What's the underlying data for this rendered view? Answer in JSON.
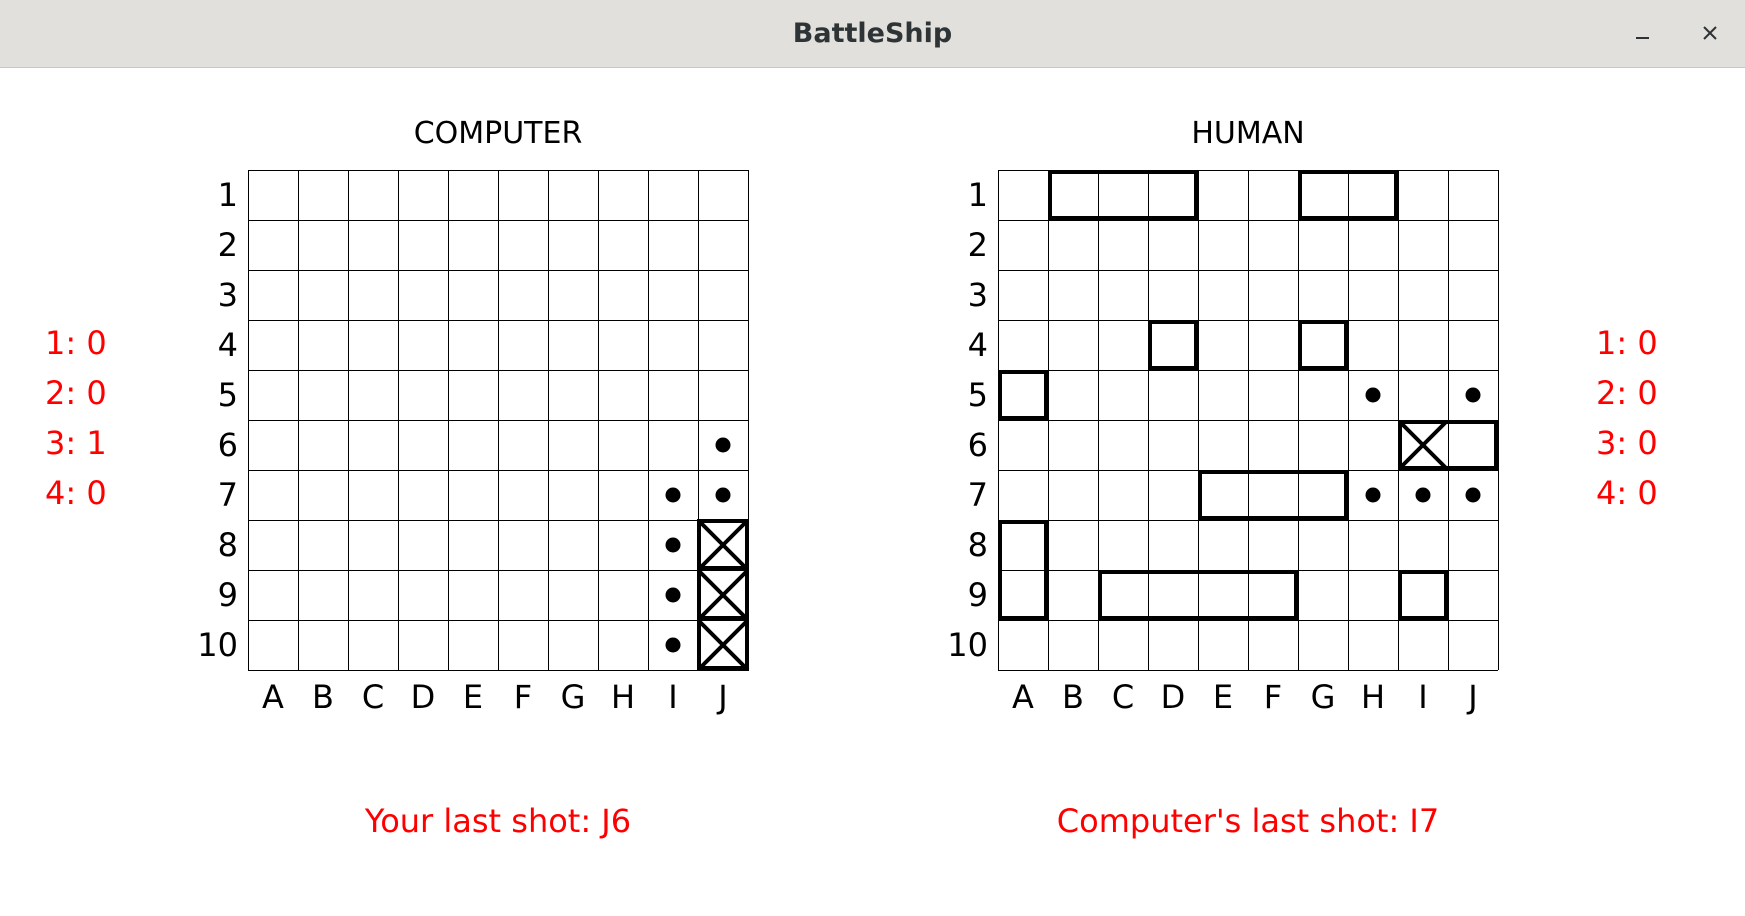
{
  "window": {
    "title": "BattleShip"
  },
  "boards": [
    {
      "id": "computer",
      "title": "COMPUTER",
      "columns": [
        "A",
        "B",
        "C",
        "D",
        "E",
        "F",
        "G",
        "H",
        "I",
        "J"
      ],
      "rows": [
        "1",
        "2",
        "3",
        "4",
        "5",
        "6",
        "7",
        "8",
        "9",
        "10"
      ],
      "ships": [],
      "hits": [
        "J8",
        "J9",
        "J10"
      ],
      "hit_blocks": [
        {
          "start": "J8",
          "end": "J10"
        }
      ],
      "misses": [
        "J6",
        "I7",
        "J7",
        "I8",
        "I9",
        "I10"
      ]
    },
    {
      "id": "human",
      "title": "HUMAN",
      "columns": [
        "A",
        "B",
        "C",
        "D",
        "E",
        "F",
        "G",
        "H",
        "I",
        "J"
      ],
      "rows": [
        "1",
        "2",
        "3",
        "4",
        "5",
        "6",
        "7",
        "8",
        "9",
        "10"
      ],
      "ships": [
        {
          "start": "B1",
          "end": "D1"
        },
        {
          "start": "G1",
          "end": "H1"
        },
        {
          "start": "D4",
          "end": "D4"
        },
        {
          "start": "G4",
          "end": "G4"
        },
        {
          "start": "A5",
          "end": "A5"
        },
        {
          "start": "I6",
          "end": "J6"
        },
        {
          "start": "E7",
          "end": "G7"
        },
        {
          "start": "A8",
          "end": "A9"
        },
        {
          "start": "C9",
          "end": "F9"
        },
        {
          "start": "I9",
          "end": "I9"
        }
      ],
      "hits": [
        "I6"
      ],
      "hit_blocks": [],
      "misses": [
        "H5",
        "J5",
        "H7",
        "I7",
        "J7"
      ]
    }
  ],
  "scores": {
    "left": [
      {
        "label": "1: 0"
      },
      {
        "label": "2: 0"
      },
      {
        "label": "3: 1"
      },
      {
        "label": "4: 0"
      }
    ],
    "right": [
      {
        "label": "1: 0"
      },
      {
        "label": "2: 0"
      },
      {
        "label": "3: 0"
      },
      {
        "label": "4: 0"
      }
    ]
  },
  "status": {
    "your_last_shot": "Your last shot: J6",
    "computer_last_shot": "Computer's last shot: I7"
  },
  "colors": {
    "status": "#ff0000",
    "grid": "#000000"
  }
}
